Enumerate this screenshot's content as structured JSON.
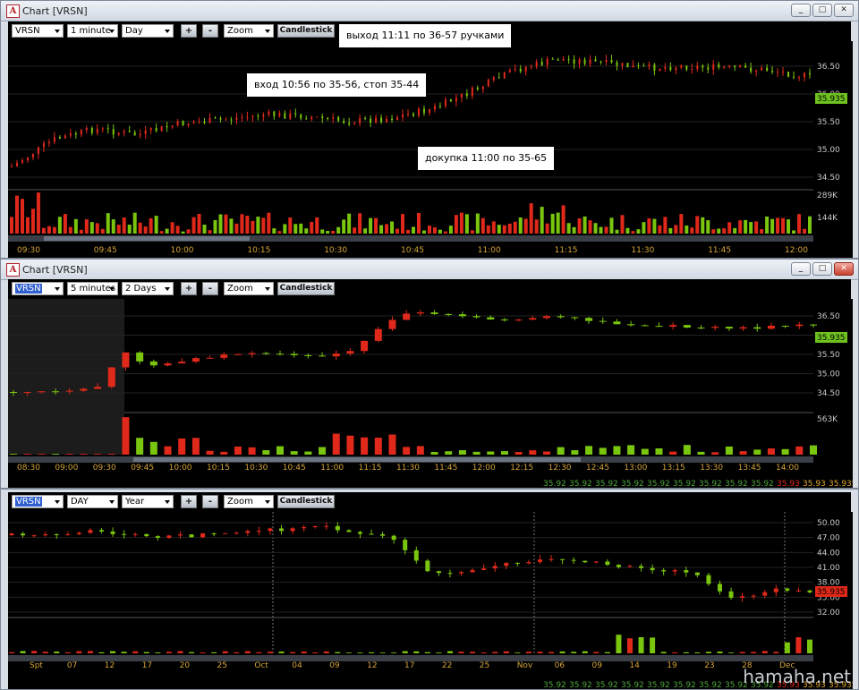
{
  "windows": [
    {
      "title": "Chart [VRSN]",
      "symbol": "VRSN",
      "interval": "1 minute",
      "range": "Day",
      "zoom": "Zoom",
      "type_btn": "Candlestick",
      "plus": "+",
      "minus": "-",
      "price_ticks": [
        "36.50",
        "36.00",
        "35.50",
        "35.00",
        "34.50"
      ],
      "last_price": "35.935",
      "volume_ticks": [
        "289K",
        "144K"
      ],
      "time_ticks": [
        "09:30",
        "09:45",
        "10:00",
        "10:15",
        "10:30",
        "10:45",
        "11:00",
        "11:15",
        "11:30",
        "11:45",
        "12:00"
      ],
      "close_highlight": false
    },
    {
      "title": "Chart [VRSN]",
      "symbol": "VRSN",
      "interval": "5 minutes",
      "range": "2 Days",
      "zoom": "Zoom",
      "type_btn": "Candlestick",
      "plus": "+",
      "minus": "-",
      "price_ticks": [
        "36.50",
        "36.00",
        "35.50",
        "35.00",
        "34.50"
      ],
      "last_price": "35.935",
      "volume_ticks": [
        "563K"
      ],
      "time_ticks": [
        "08:30",
        "09:00",
        "09:30",
        "09:45",
        "10:00",
        "10:15",
        "10:30",
        "10:45",
        "11:00",
        "11:15",
        "11:30",
        "11:45",
        "12:00",
        "12:15",
        "12:30",
        "12:45",
        "13:00",
        "13:15",
        "13:30",
        "13:45",
        "14:00"
      ],
      "status": [
        "35.92",
        "35.92",
        "35.92",
        "35.92",
        "35.92",
        "35.92",
        "35.92",
        "35.92",
        "35.92",
        "35.93",
        "35.93",
        "35.935"
      ],
      "close_highlight": true
    },
    {
      "symbol": "VRSN",
      "interval": "DAY",
      "range": "Year",
      "zoom": "Zoom",
      "type_btn": "Candlestick",
      "plus": "+",
      "minus": "-",
      "price_ticks": [
        "50.00",
        "47.00",
        "44.00",
        "41.00",
        "38.00",
        "35.00",
        "32.00"
      ],
      "last_price": "35.935",
      "time_ticks": [
        "Spt",
        "07",
        "12",
        "17",
        "20",
        "25",
        "Oct",
        "04",
        "09",
        "12",
        "17",
        "22",
        "25",
        "Nov",
        "06",
        "09",
        "14",
        "19",
        "23",
        "28",
        "Dec"
      ],
      "status": [
        "35.92",
        "35.92",
        "35.92",
        "35.92",
        "35.92",
        "35.92",
        "35.92",
        "35.92",
        "35.92",
        "35.93",
        "35.93",
        "35.935"
      ]
    }
  ],
  "annotations": {
    "exit": "выход 11:11 по 36-57 ручками",
    "entry": "вход 10:56 по 35-56, стоп 35-44",
    "add": "докупка 11:00 по 35-65"
  },
  "watermark": "hamaha.net",
  "colors": {
    "up": "#7ac60e",
    "down": "#e0291b",
    "bg": "#000000",
    "grid": "#2a2a2a",
    "arrow_red": "#d8141b",
    "arrow_green": "#5aa51a",
    "axis_text": "#c8c8c8",
    "time_text": "#d6a437"
  }
}
